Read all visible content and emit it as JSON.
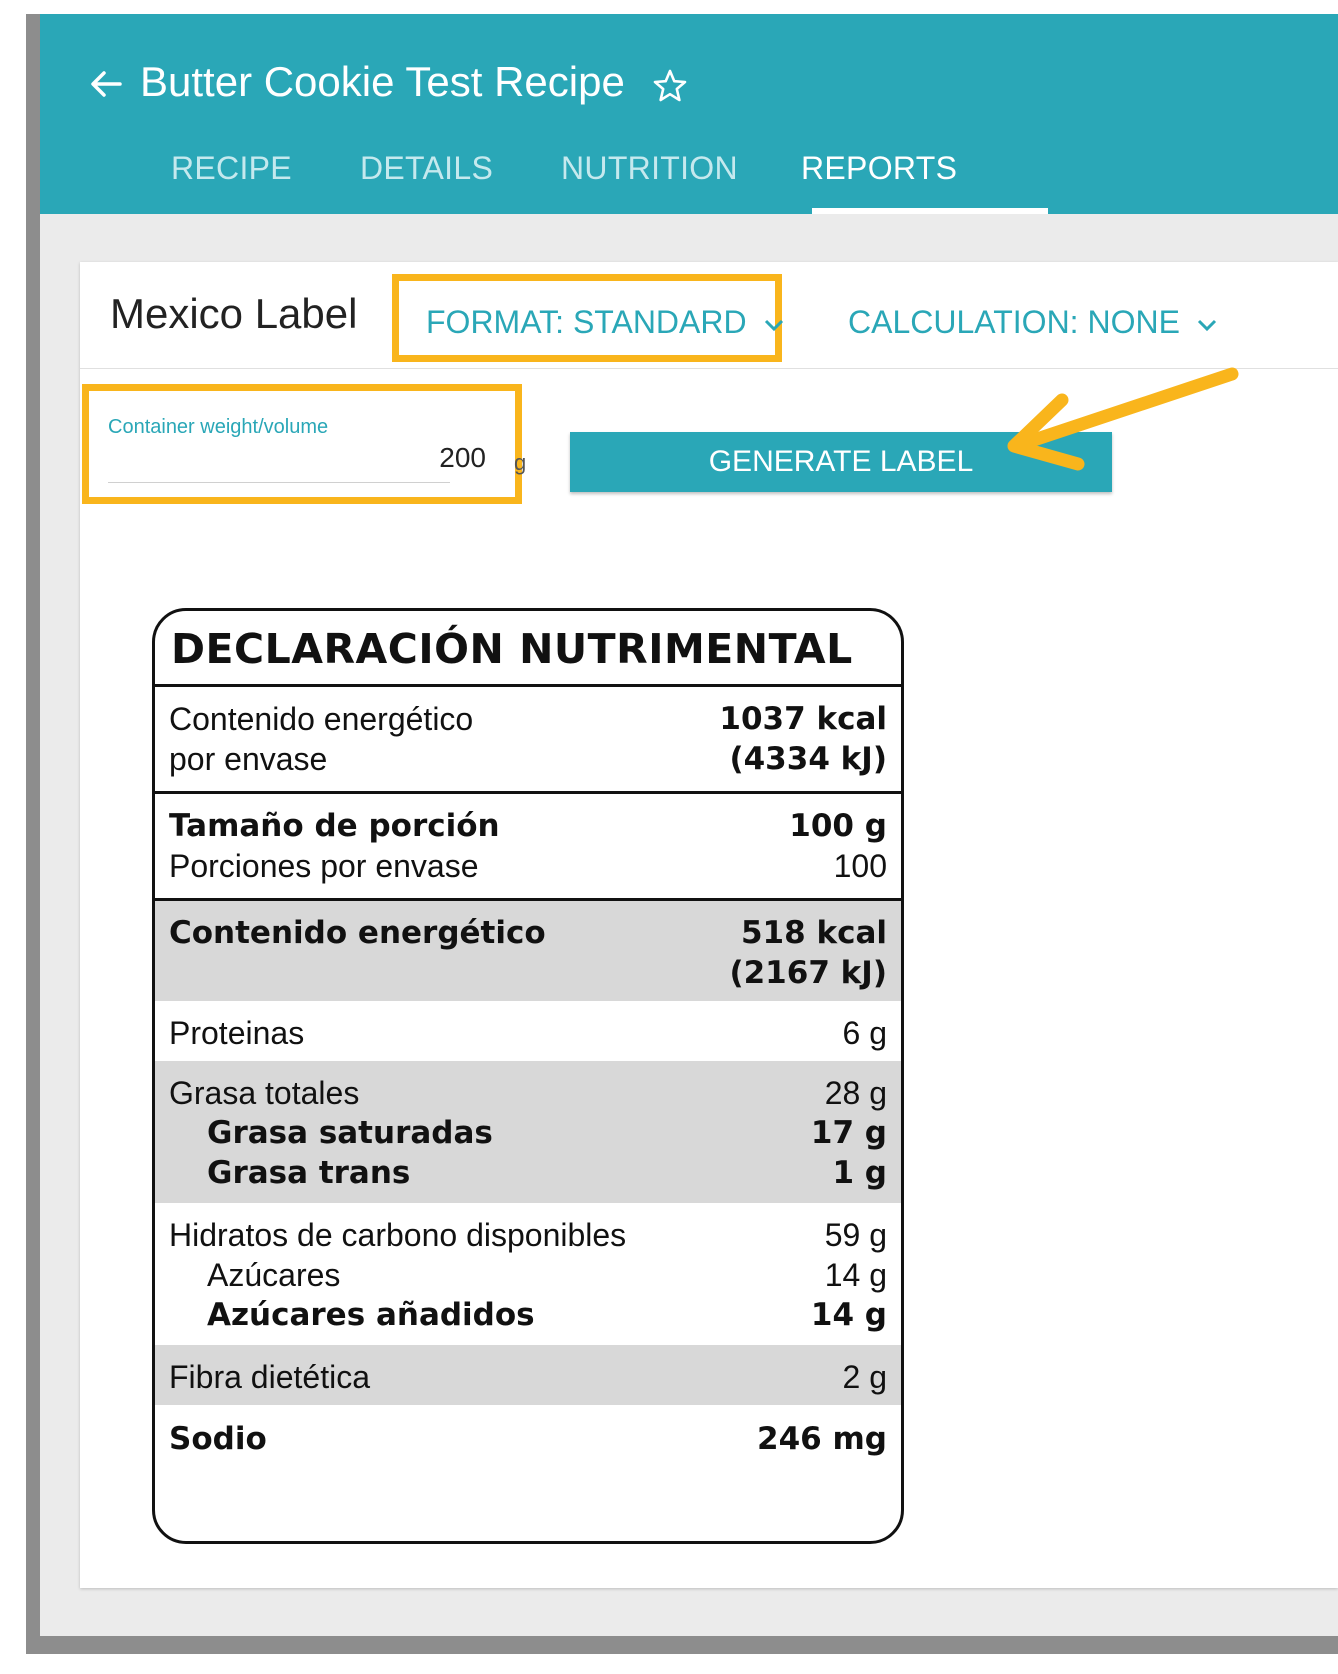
{
  "header": {
    "title": "Butter Cookie Test Recipe",
    "back_icon": "arrow-left-icon",
    "favorite_icon": "star-outline-icon"
  },
  "tabs": [
    {
      "label": "RECIPE",
      "active": false
    },
    {
      "label": "DETAILS",
      "active": false
    },
    {
      "label": "NUTRITION",
      "active": false
    },
    {
      "label": "REPORTS",
      "active": true
    }
  ],
  "report": {
    "title": "Mexico Label",
    "format_dropdown": "FORMAT: STANDARD",
    "calculation_dropdown": "CALCULATION: NONE",
    "container_field": {
      "label": "Container weight/volume",
      "value": "200",
      "unit": "g"
    },
    "generate_button": "GENERATE LABEL"
  },
  "colors": {
    "accent": "#2aa7b7",
    "highlight": "#f9b51c",
    "shade": "#d8d8d8"
  },
  "nutrition_label": {
    "title": "DECLARACIÓN NUTRIMENTAL",
    "energy_per_container": {
      "label_line1": "Contenido energético",
      "label_line2": "por envase",
      "kcal": "1037 kcal",
      "kj": "(4334 kJ)"
    },
    "serving_size": {
      "label": "Tamaño de porción",
      "value": "100 g"
    },
    "servings": {
      "label": "Porciones por envase",
      "value": "100"
    },
    "energy": {
      "label": "Contenido energético",
      "kcal": "518 kcal",
      "kj": "(2167 kJ)"
    },
    "protein": {
      "label": "Proteinas",
      "value": "6 g"
    },
    "fat_total": {
      "label": "Grasa totales",
      "value": "28 g"
    },
    "fat_saturated": {
      "label": "Grasa saturadas",
      "value": "17 g"
    },
    "fat_trans": {
      "label": "Grasa trans",
      "value": "1 g"
    },
    "carbs": {
      "label": "Hidratos de carbono disponibles",
      "value": "59 g"
    },
    "sugars": {
      "label": "Azúcares",
      "value": "14 g"
    },
    "added_sugars": {
      "label": "Azúcares añadidos",
      "value": "14 g"
    },
    "fiber": {
      "label": "Fibra dietética",
      "value": "2 g"
    },
    "sodium": {
      "label": "Sodio",
      "value": "246 mg"
    }
  }
}
